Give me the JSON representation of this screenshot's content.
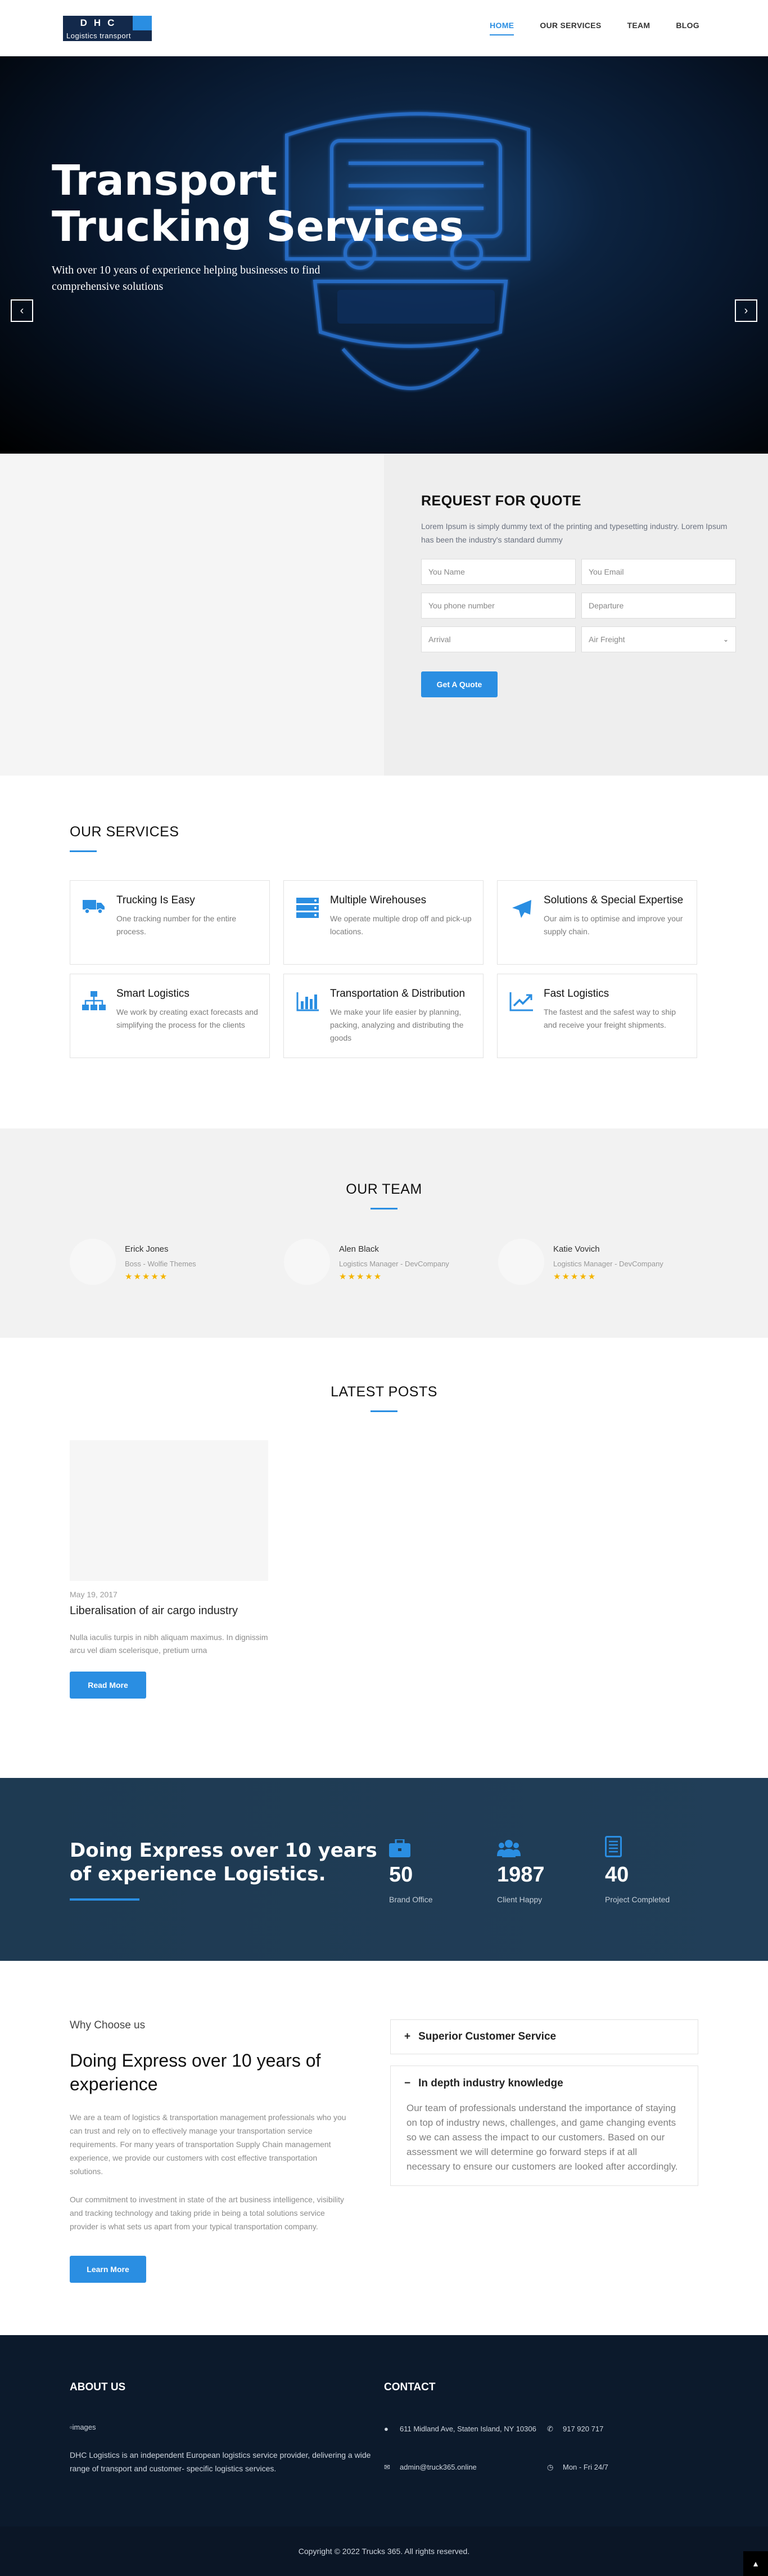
{
  "header": {
    "logo_letters": "DHC",
    "logo_sub": "Logistics transport",
    "nav": [
      {
        "label": "HOME",
        "active": true
      },
      {
        "label": "OUR SERVICES",
        "active": false
      },
      {
        "label": "TEAM",
        "active": false
      },
      {
        "label": "BLOG",
        "active": false
      }
    ]
  },
  "hero": {
    "title_line1": "Transport",
    "title_line2": "Trucking Services",
    "subtitle": "With over 10 years of experience helping businesses to find comprehensive solutions",
    "prev_icon": "chevron-left-icon",
    "next_icon": "chevron-right-icon"
  },
  "quote": {
    "title": "REQUEST FOR QUOTE",
    "text": "Lorem Ipsum is simply dummy text of the printing and typesetting industry. Lorem Ipsum has been the industry's standard dummy",
    "fields": {
      "name": "You Name",
      "email": "You Email",
      "phone": "You phone number",
      "departure": "Departure",
      "arrival": "Arrival",
      "freight": "Air Freight"
    },
    "button": "Get A Quote"
  },
  "services": {
    "title": "OUR SERVICES",
    "items": [
      {
        "title": "Trucking Is Easy",
        "text": "One tracking number for the entire process.",
        "icon": "truck-icon"
      },
      {
        "title": "Multiple Wirehouses",
        "text": "We operate multiple drop off and pick-up locations.",
        "icon": "server-icon"
      },
      {
        "title": "Solutions & Special Expertise",
        "text": "Our aim is to optimise and improve your supply chain.",
        "icon": "plane-icon"
      },
      {
        "title": "Smart Logistics",
        "text": "We work by creating exact forecasts and simplifying the process for the clients",
        "icon": "sitemap-icon"
      },
      {
        "title": "Transportation & Distribution",
        "text": "We make your life easier by planning, packing, analyzing and distributing the goods",
        "icon": "bar-chart-icon"
      },
      {
        "title": "Fast Logistics",
        "text": "The fastest and the safest way to ship and receive your freight shipments.",
        "icon": "trend-chart-icon"
      }
    ]
  },
  "team": {
    "title": "OUR TEAM",
    "members": [
      {
        "name": "Erick Jones",
        "role": "Boss - Wolfie Themes",
        "stars": "★★★★★"
      },
      {
        "name": "Alen Black",
        "role": "Logistics Manager - DevCompany",
        "stars": "★★★★★"
      },
      {
        "name": "Katie Vovich",
        "role": "Logistics Manager - DevCompany",
        "stars": "★★★★★"
      }
    ]
  },
  "posts": {
    "title": "LATEST POSTS",
    "items": [
      {
        "date": "May 19, 2017",
        "title": "Liberalisation of air cargo industry",
        "excerpt": "Nulla iaculis turpis in nibh aliquam maximus. In dignissim arcu vel diam scelerisque, pretium urna",
        "button": "Read More"
      }
    ]
  },
  "stats": {
    "title": "Doing Express over 10 years of experience Logistics.",
    "counters": [
      {
        "number": "50",
        "label": "Brand Office",
        "icon": "briefcase-icon"
      },
      {
        "number": "1987",
        "label": "Client Happy",
        "icon": "users-icon"
      },
      {
        "number": "40",
        "label": "Project Completed",
        "icon": "file-icon"
      }
    ]
  },
  "why": {
    "kicker": "Why Choose us",
    "title": "Doing Express over 10 years of experience",
    "p1": "We are a team of logistics & transportation management professionals who you can trust and rely on to effectively manage your transportation service requirements. For many years of transportation Supply Chain management experience, we provide our customers with cost effective transportation solutions.",
    "p2": "Our commitment to investment in state of the art business intelligence, visibility and tracking technology and taking pride in being a total solutions service provider is what sets us apart from your typical transportation company.",
    "button": "Learn More",
    "accordion": [
      {
        "title": "Superior Customer Service",
        "sign": "+"
      },
      {
        "title": "In depth industry knowledge",
        "sign": "−",
        "body": "Our team of professionals understand the importance of staying on top of industry news, challenges, and game changing events so we can assess the impact to our customers. Based on our assessment we will determine go forward steps if at all necessary to ensure our customers are looked after accordingly."
      }
    ]
  },
  "footer": {
    "about_title": "ABOUT US",
    "image_alt": "images",
    "about_text": "DHC Logistics is an independent European logistics service provider, delivering a wide range of transport and customer- specific logistics services.",
    "contact_title": "CONTACT",
    "address": "611 Midland Ave, Staten Island, NY 10306",
    "phone": "917 920 717",
    "email": "admin@truck365.online",
    "hours": "Mon - Fri 24/7",
    "copyright": "Copyright © 2022 Trucks 365. All rights reserved."
  },
  "colors": {
    "accent": "#2a8ee2",
    "navy": "#13294b",
    "stats_bg": "#1e3a52",
    "footer_bg": "#0c1a2c"
  }
}
